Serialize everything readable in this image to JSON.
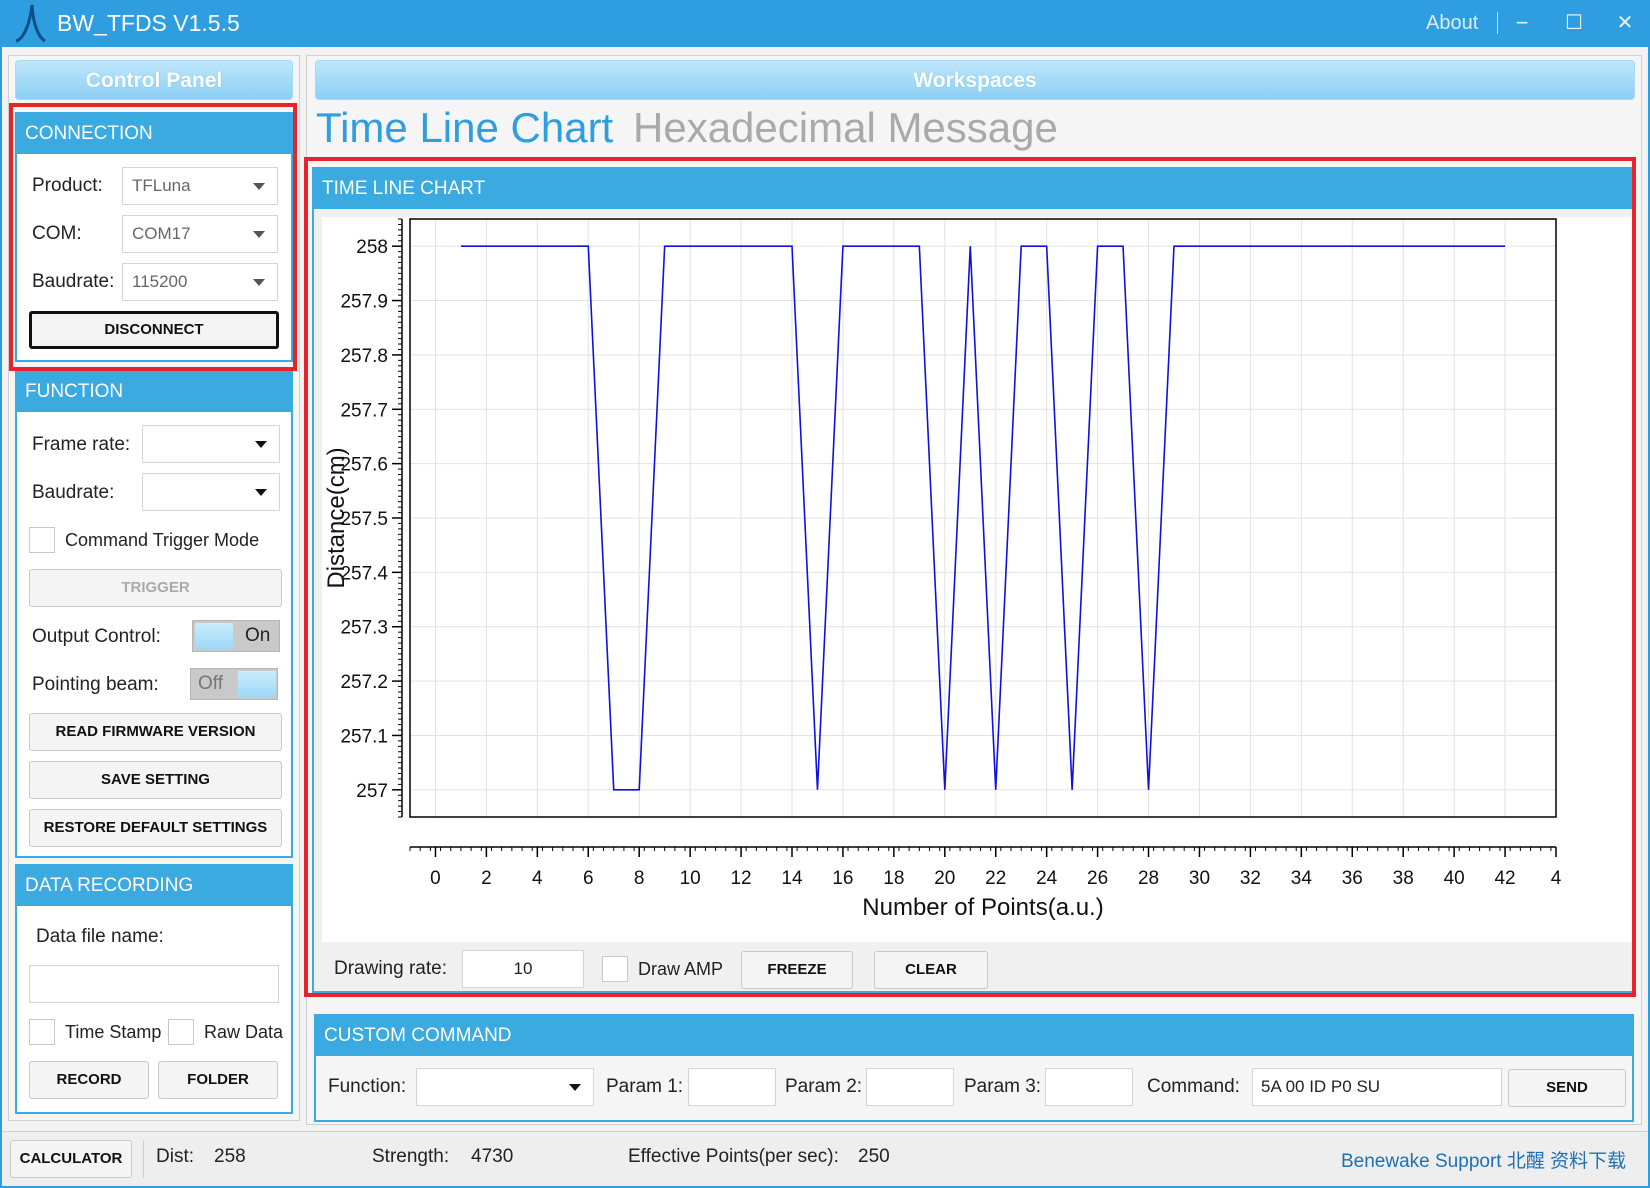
{
  "window": {
    "title": "BW_TFDS V1.5.5",
    "about": "About",
    "minimize_icon": "−",
    "maximize_icon": "☐",
    "close_icon": "✕"
  },
  "control_panel": {
    "title": "Control Panel",
    "connection": {
      "header": "CONNECTION",
      "product_label": "Product:",
      "product_value": "TFLuna",
      "com_label": "COM:",
      "com_value": "COM17",
      "baudrate_label": "Baudrate:",
      "baudrate_value": "115200",
      "disconnect_label": "DISCONNECT"
    },
    "function": {
      "header": "FUNCTION",
      "frame_rate_label": "Frame rate:",
      "frame_rate_value": "",
      "baudrate_label": "Baudrate:",
      "baudrate_value": "",
      "command_trigger_label": "Command Trigger Mode",
      "trigger_label": "TRIGGER",
      "output_control_label": "Output Control:",
      "output_control_state": "On",
      "pointing_beam_label": "Pointing beam:",
      "pointing_beam_state": "Off",
      "read_firmware_label": "READ FIRMWARE VERSION",
      "save_setting_label": "SAVE SETTING",
      "restore_default_label": "RESTORE DEFAULT SETTINGS"
    },
    "data_recording": {
      "header": "DATA RECORDING",
      "file_name_label": "Data file name:",
      "file_name_value": "",
      "time_stamp_label": "Time Stamp",
      "raw_data_label": "Raw Data",
      "record_label": "RECORD",
      "folder_label": "FOLDER"
    }
  },
  "workspaces": {
    "title": "Workspaces",
    "tabs": [
      {
        "label": "Time Line Chart",
        "active": true
      },
      {
        "label": "Hexadecimal Message",
        "active": false
      }
    ],
    "time_line_chart": {
      "header": "TIME LINE CHART",
      "drawing_rate_label": "Drawing rate:",
      "drawing_rate_value": "10",
      "draw_amp_label": "Draw AMP",
      "freeze_label": "FREEZE",
      "clear_label": "CLEAR"
    },
    "custom_command": {
      "header": "CUSTOM COMMAND",
      "function_label": "Function:",
      "function_value": "",
      "param1_label": "Param 1:",
      "param2_label": "Param 2:",
      "param3_label": "Param 3:",
      "command_label": "Command:",
      "command_value": "5A 00 ID P0 SU",
      "send_label": "SEND"
    }
  },
  "status_bar": {
    "calculator_label": "CALCULATOR",
    "dist_label": "Dist:",
    "dist_value": "258",
    "strength_label": "Strength:",
    "strength_value": "4730",
    "effective_points_label": "Effective Points(per sec):",
    "effective_points_value": "250",
    "support_link": "Benewake Support 北醒 资料下载"
  },
  "colors": {
    "accent": "#2f9ee0",
    "section_header": "#3aaae0",
    "highlight": "#e8232a",
    "series_line": "#1010e0"
  },
  "chart_data": {
    "type": "line",
    "xlabel": "Number of Points(a.u.)",
    "ylabel": "Distance(cm)",
    "xlim": [
      -1,
      44
    ],
    "ylim": [
      256.95,
      258.05
    ],
    "x_ticks": [
      0,
      2,
      4,
      6,
      8,
      10,
      12,
      14,
      16,
      18,
      20,
      22,
      24,
      26,
      28,
      30,
      32,
      34,
      36,
      38,
      40,
      42,
      4
    ],
    "y_ticks": [
      "258",
      "257.9",
      "257.8",
      "257.7",
      "257.6",
      "257.5",
      "257.4",
      "257.3",
      "257.2",
      "257.1",
      "257"
    ],
    "grid": true,
    "series": [
      {
        "color": "#1010e0",
        "x": [
          1,
          6,
          7,
          8,
          9,
          14,
          15,
          16,
          19,
          20,
          21,
          22,
          23,
          24,
          25,
          26,
          27,
          28,
          29,
          42
        ],
        "y": [
          258,
          258,
          257,
          257,
          258,
          258,
          257,
          258,
          258,
          257,
          258,
          257,
          258,
          258,
          257,
          258,
          258,
          257,
          258,
          258
        ]
      }
    ]
  }
}
